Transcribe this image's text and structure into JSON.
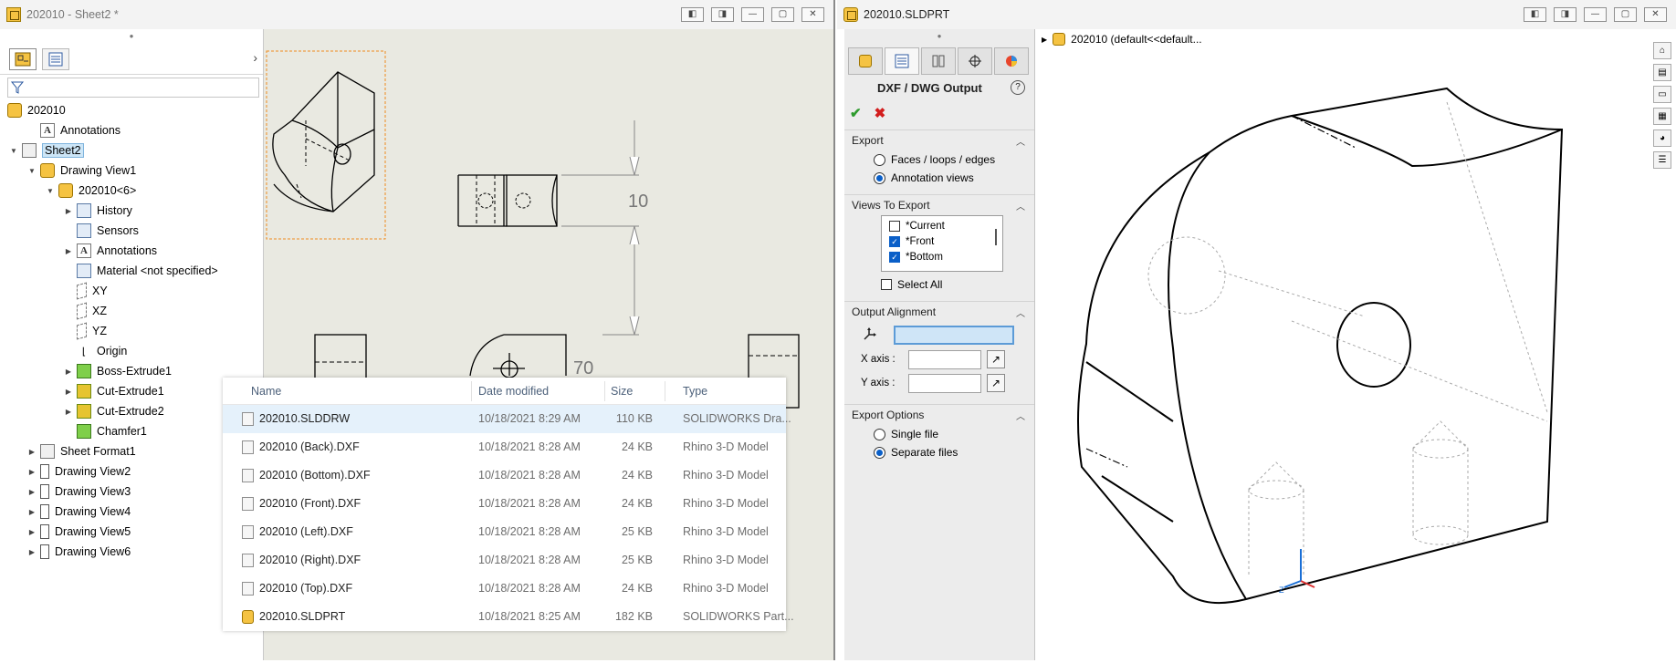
{
  "left_window": {
    "title": "202010 - Sheet2 *",
    "win_buttons": [
      "◧",
      "◨",
      "—",
      "▢",
      "✕"
    ]
  },
  "feature_tree": {
    "items": [
      {
        "label": "202010",
        "icon": "drawing-icon",
        "level": 0,
        "arrow": ""
      },
      {
        "label": "Annotations",
        "icon": "annotations-icon",
        "level": 1,
        "arrow": ""
      },
      {
        "label": "Sheet2",
        "icon": "sheet-icon",
        "level": 0,
        "arrow": "▼",
        "selected": true
      },
      {
        "label": "Drawing View1",
        "icon": "part-icon",
        "level": 1,
        "arrow": "▼"
      },
      {
        "label": "202010<6>",
        "icon": "part-icon",
        "level": 2,
        "arrow": "▼"
      },
      {
        "label": "History",
        "icon": "history-folder-icon",
        "level": 3,
        "arrow": "▶"
      },
      {
        "label": "Sensors",
        "icon": "sensors-icon",
        "level": 3,
        "arrow": ""
      },
      {
        "label": "Annotations",
        "icon": "annotations-icon",
        "level": 3,
        "arrow": "▶"
      },
      {
        "label": "Material <not specified>",
        "icon": "material-icon",
        "level": 3,
        "arrow": ""
      },
      {
        "label": "XY",
        "icon": "plane-icon",
        "level": 3,
        "arrow": ""
      },
      {
        "label": "XZ",
        "icon": "plane-icon",
        "level": 3,
        "arrow": ""
      },
      {
        "label": "YZ",
        "icon": "plane-icon",
        "level": 3,
        "arrow": ""
      },
      {
        "label": "Origin",
        "icon": "origin-icon",
        "level": 3,
        "arrow": ""
      },
      {
        "label": "Boss-Extrude1",
        "icon": "boss-extrude-icon",
        "level": 3,
        "arrow": "▶"
      },
      {
        "label": "Cut-Extrude1",
        "icon": "cut-extrude-icon",
        "level": 3,
        "arrow": "▶"
      },
      {
        "label": "Cut-Extrude2",
        "icon": "cut-extrude-icon",
        "level": 3,
        "arrow": "▶"
      },
      {
        "label": "Chamfer1",
        "icon": "chamfer-icon",
        "level": 3,
        "arrow": ""
      },
      {
        "label": "Sheet Format1",
        "icon": "sheet-format-icon",
        "level": 1,
        "arrow": "▶"
      },
      {
        "label": "Drawing View2",
        "icon": "drawing-view-icon",
        "level": 1,
        "arrow": "▶"
      },
      {
        "label": "Drawing View3",
        "icon": "drawing-view-icon",
        "level": 1,
        "arrow": "▶"
      },
      {
        "label": "Drawing View4",
        "icon": "drawing-view-icon",
        "level": 1,
        "arrow": "▶"
      },
      {
        "label": "Drawing View5",
        "icon": "drawing-view-icon",
        "level": 1,
        "arrow": "▶"
      },
      {
        "label": "Drawing View6",
        "icon": "drawing-view-icon",
        "level": 1,
        "arrow": "▶"
      }
    ]
  },
  "drawing": {
    "dimension_text": "10",
    "partial_dimension": "70"
  },
  "file_list": {
    "columns": {
      "name": "Name",
      "date": "Date modified",
      "size": "Size",
      "type": "Type"
    },
    "rows": [
      {
        "name": "202010.SLDDRW",
        "date": "10/18/2021 8:29 AM",
        "size": "110 KB",
        "type": "SOLIDWORKS Dra...",
        "icon": "drawing-file-icon",
        "selected": true
      },
      {
        "name": "202010 (Back).DXF",
        "date": "10/18/2021 8:28 AM",
        "size": "24 KB",
        "type": "Rhino 3-D Model",
        "icon": "dxf-file-icon"
      },
      {
        "name": "202010 (Bottom).DXF",
        "date": "10/18/2021 8:28 AM",
        "size": "24 KB",
        "type": "Rhino 3-D Model",
        "icon": "dxf-file-icon"
      },
      {
        "name": "202010 (Front).DXF",
        "date": "10/18/2021 8:28 AM",
        "size": "24 KB",
        "type": "Rhino 3-D Model",
        "icon": "dxf-file-icon"
      },
      {
        "name": "202010 (Left).DXF",
        "date": "10/18/2021 8:28 AM",
        "size": "25 KB",
        "type": "Rhino 3-D Model",
        "icon": "dxf-file-icon"
      },
      {
        "name": "202010 (Right).DXF",
        "date": "10/18/2021 8:28 AM",
        "size": "25 KB",
        "type": "Rhino 3-D Model",
        "icon": "dxf-file-icon"
      },
      {
        "name": "202010 (Top).DXF",
        "date": "10/18/2021 8:28 AM",
        "size": "24 KB",
        "type": "Rhino 3-D Model",
        "icon": "dxf-file-icon"
      },
      {
        "name": "202010.SLDPRT",
        "date": "10/18/2021 8:25 AM",
        "size": "182 KB",
        "type": "SOLIDWORKS Part...",
        "icon": "part-file-icon"
      }
    ]
  },
  "right_window": {
    "title": "202010.SLDPRT",
    "win_buttons": [
      "◧",
      "◨",
      "—",
      "▢",
      "✕"
    ],
    "tree_root": "202010  (default<<default..."
  },
  "property_manager": {
    "title": "DXF / DWG Output",
    "help": "?",
    "export": {
      "title": "Export",
      "options": [
        {
          "label": "Faces / loops / edges",
          "selected": false
        },
        {
          "label": "Annotation views",
          "selected": true
        }
      ]
    },
    "views_to_export": {
      "title": "Views To Export",
      "items": [
        {
          "label": "*Current",
          "checked": false
        },
        {
          "label": "*Front",
          "checked": true
        },
        {
          "label": "*Bottom",
          "checked": true
        }
      ],
      "select_all": "Select All"
    },
    "output_alignment": {
      "title": "Output Alignment",
      "x_axis": "X axis :",
      "y_axis": "Y axis :"
    },
    "export_options": {
      "title": "Export Options",
      "options": [
        {
          "label": "Single file",
          "selected": false
        },
        {
          "label": "Separate files",
          "selected": true
        }
      ]
    }
  }
}
